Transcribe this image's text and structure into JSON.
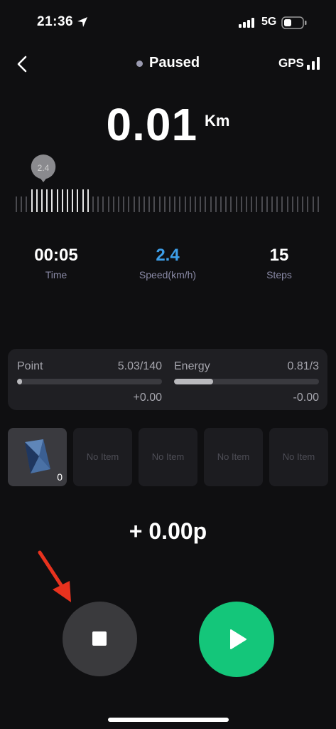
{
  "status_bar": {
    "time": "21:36",
    "network": "5G",
    "icons": [
      "location-arrow-icon",
      "cell-signal-icon",
      "battery-icon"
    ]
  },
  "header": {
    "status": "Paused",
    "gps_label": "GPS",
    "icons": [
      "back-chevron-icon",
      "gps-signal-icon"
    ]
  },
  "distance": {
    "value": "0.01",
    "unit": "Km"
  },
  "speed_indicator": {
    "bubble_value": "2.4"
  },
  "stats": {
    "time": {
      "value": "00:05",
      "label": "Time"
    },
    "speed": {
      "value": "2.4",
      "label": "Speed(km/h)"
    },
    "steps": {
      "value": "15",
      "label": "Steps"
    }
  },
  "point": {
    "label": "Point",
    "value": "5.03/140",
    "delta": "+0.00",
    "fill_fraction": 0.036
  },
  "energy": {
    "label": "Energy",
    "value": "0.81/3",
    "delta": "-0.00",
    "fill_fraction": 0.27
  },
  "items": {
    "first_count": "0",
    "empty_label": "No Item",
    "empty_slots": [
      "No Item",
      "No Item",
      "No Item",
      "No Item"
    ]
  },
  "reward": "+ 0.00p",
  "colors": {
    "background": "#0f0f11",
    "accent_blue": "#3d9ee8",
    "play_green": "#14c67a",
    "annotation_red": "#e8321e"
  }
}
